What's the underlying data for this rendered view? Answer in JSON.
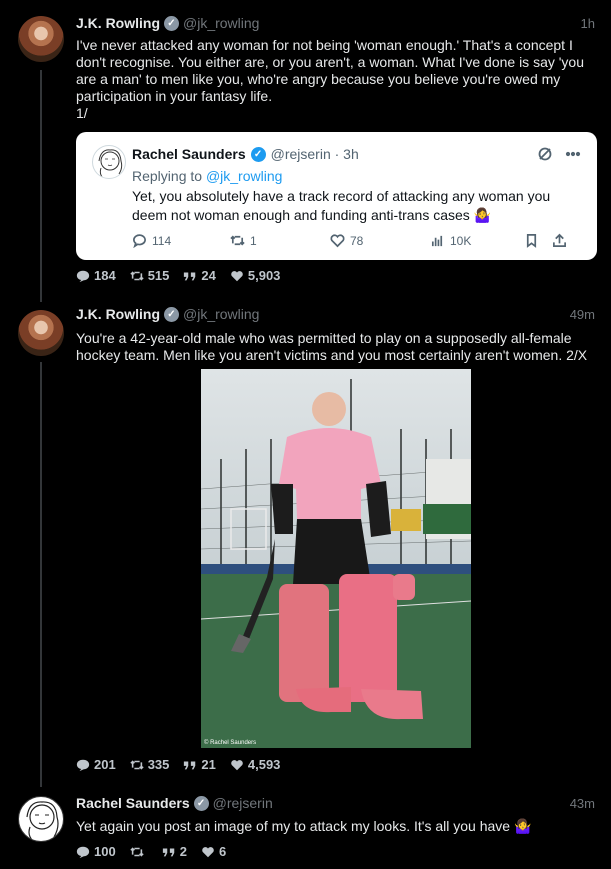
{
  "tweets": [
    {
      "name": "J.K. Rowling",
      "handle": "@jk_rowling",
      "time": "1h",
      "text": "I've never attacked any woman for not being 'woman enough.' That's a concept I\ndon't recognise. You either are, or you aren't, a woman. What I've done is say 'you\nare a man' to men like you, who're angry because you believe you're owed my\nparticipation in your fantasy life.\n1/",
      "stats": {
        "replies": "184",
        "retweets": "515",
        "quotes": "24",
        "likes": "5,903"
      },
      "quote": {
        "name": "Rachel Saunders",
        "handle": "@rejserin · 3h",
        "replying_prefix": "Replying to ",
        "replying_handle": "@jk_rowling",
        "text": "Yet, you absolutely have a track record of attacking any woman you deem not woman enough and funding anti-trans cases 🤷‍♀️",
        "replies": "114",
        "retweets": "1",
        "likes": "78",
        "views": "10K"
      }
    },
    {
      "name": "J.K. Rowling",
      "handle": "@jk_rowling",
      "time": "49m",
      "text": "You're a 42-year-old male who was permitted to play on a supposedly all-female\nhockey team. Men like you aren't victims and you most certainly aren't women. 2/X",
      "photo_caption": "© Rachel Saunders",
      "stats": {
        "replies": "201",
        "retweets": "335",
        "quotes": "21",
        "likes": "4,593"
      }
    },
    {
      "name": "Rachel Saunders",
      "handle": "@rejserin",
      "time": "43m",
      "text": "Yet again you post an image of my to attack my looks. It's all you have 🤷‍♀️",
      "stats": {
        "replies": "100",
        "retweets": "",
        "quotes": "2",
        "likes": "6"
      }
    }
  ],
  "colors": {
    "accent": "#1d9bf0",
    "background": "#000000",
    "muted": "#71767b"
  }
}
